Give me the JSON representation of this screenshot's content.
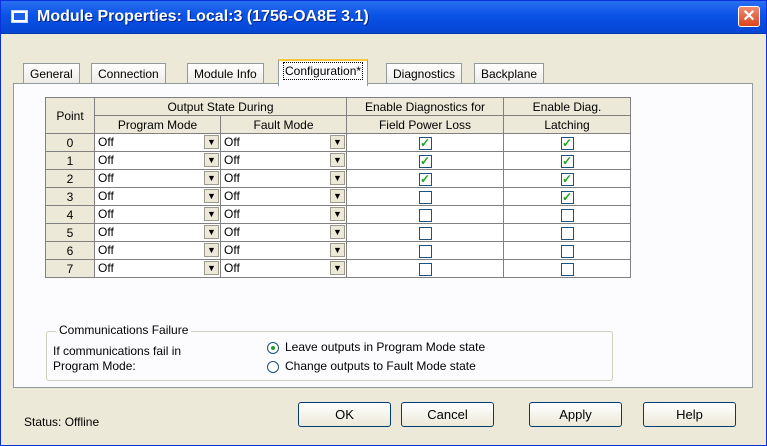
{
  "window": {
    "title": "Module Properties: Local:3 (1756-OA8E 3.1)",
    "close_glyph": "✕"
  },
  "tabs": [
    {
      "label": "General"
    },
    {
      "label": "Connection"
    },
    {
      "label": "Module Info"
    },
    {
      "label": "Configuration*"
    },
    {
      "label": "Diagnostics"
    },
    {
      "label": "Backplane"
    }
  ],
  "table": {
    "headers": {
      "point": "Point",
      "output_state_during": "Output State During",
      "program_mode": "Program Mode",
      "fault_mode": "Fault Mode",
      "enable_diag_1": "Enable Diagnostics for",
      "enable_diag_2": "Field Power Loss",
      "enable_latch_1": "Enable Diag.",
      "enable_latch_2": "Latching"
    },
    "rows": [
      {
        "point": "0",
        "program_mode": "Off",
        "fault_mode": "Off",
        "diag": true,
        "latch": true
      },
      {
        "point": "1",
        "program_mode": "Off",
        "fault_mode": "Off",
        "diag": true,
        "latch": true
      },
      {
        "point": "2",
        "program_mode": "Off",
        "fault_mode": "Off",
        "diag": true,
        "latch": true
      },
      {
        "point": "3",
        "program_mode": "Off",
        "fault_mode": "Off",
        "diag": false,
        "latch": true
      },
      {
        "point": "4",
        "program_mode": "Off",
        "fault_mode": "Off",
        "diag": false,
        "latch": false
      },
      {
        "point": "5",
        "program_mode": "Off",
        "fault_mode": "Off",
        "diag": false,
        "latch": false
      },
      {
        "point": "6",
        "program_mode": "Off",
        "fault_mode": "Off",
        "diag": false,
        "latch": false
      },
      {
        "point": "7",
        "program_mode": "Off",
        "fault_mode": "Off",
        "diag": false,
        "latch": false
      }
    ]
  },
  "comm_failure": {
    "legend": "Communications Failure",
    "description_line1": "If communications fail in",
    "description_line2": "Program Mode:",
    "options": [
      {
        "label": "Leave outputs in Program Mode state",
        "selected": true
      },
      {
        "label": "Change outputs to Fault Mode state",
        "selected": false
      }
    ]
  },
  "status": {
    "text": "Status:  Offline"
  },
  "buttons": {
    "ok": "OK",
    "cancel": "Cancel",
    "apply": "Apply",
    "help": "Help"
  },
  "icons": {
    "dropdown": "chevron-down-icon",
    "check": "checkmark-icon",
    "close": "close-icon",
    "app": "window-icon"
  }
}
